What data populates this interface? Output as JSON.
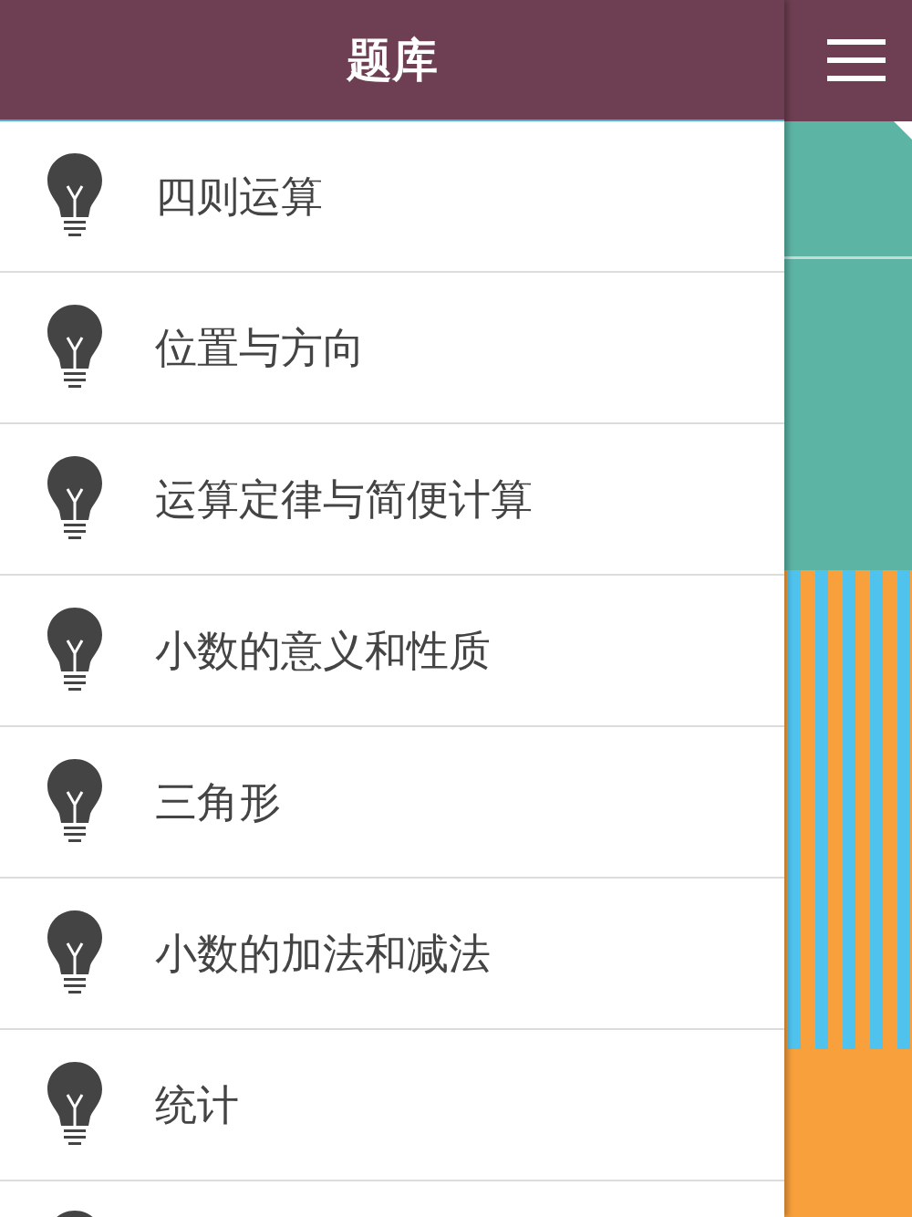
{
  "header": {
    "title": "题库"
  },
  "items": [
    {
      "label": "四则运算"
    },
    {
      "label": "位置与方向"
    },
    {
      "label": "运算定律与简便计算"
    },
    {
      "label": "小数的意义和性质"
    },
    {
      "label": "三角形"
    },
    {
      "label": "小数的加法和减法"
    },
    {
      "label": "统计"
    }
  ]
}
